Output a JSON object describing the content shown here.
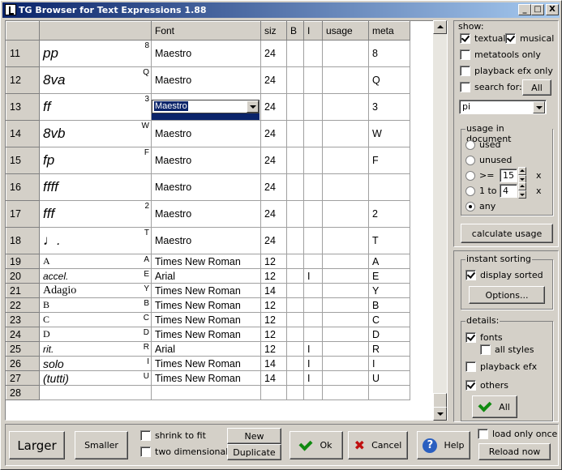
{
  "window": {
    "title": "TG Browser for Text Expressions 1.88",
    "min": "_",
    "max": "□",
    "close": "X"
  },
  "grid": {
    "headers": [
      "",
      "",
      "Font",
      "siz",
      "B",
      "I",
      "usage",
      "meta"
    ],
    "rows": [
      {
        "num": "11",
        "mark": "pp",
        "sup": "8",
        "font": "Maestro",
        "size": "24",
        "b": "",
        "i": "",
        "usage": "",
        "meta": "8"
      },
      {
        "num": "12",
        "mark": "8va",
        "sup": "Q",
        "font": "Maestro",
        "size": "24",
        "b": "",
        "i": "",
        "usage": "",
        "meta": "Q"
      },
      {
        "num": "13",
        "mark": "ff",
        "sup": "3",
        "font": "Maestro",
        "size": "24",
        "b": "",
        "i": "",
        "usage": "",
        "meta": "3"
      },
      {
        "num": "14",
        "mark": "8vb",
        "sup": "W",
        "font": "Maestro",
        "size": "24",
        "b": "",
        "i": "",
        "usage": "",
        "meta": "W"
      },
      {
        "num": "15",
        "mark": "fp",
        "sup": "F",
        "font": "Maestro",
        "size": "24",
        "b": "",
        "i": "",
        "usage": "",
        "meta": "F"
      },
      {
        "num": "16",
        "mark": "ffff",
        "sup": "",
        "font": "Maestro",
        "size": "24",
        "b": "",
        "i": "",
        "usage": "",
        "meta": ""
      },
      {
        "num": "17",
        "mark": "fff",
        "sup": "2",
        "font": "Maestro",
        "size": "24",
        "b": "",
        "i": "",
        "usage": "",
        "meta": "2"
      },
      {
        "num": "18",
        "mark": "♩.",
        "sup": "T",
        "font": "Maestro",
        "size": "24",
        "b": "",
        "i": "",
        "usage": "",
        "meta": "T"
      }
    ],
    "small_rows": [
      {
        "num": "19",
        "mark": "A",
        "sup": "A",
        "style": "roman",
        "font": "Times New Roman",
        "size": "12",
        "b": "",
        "i": "",
        "usage": "",
        "meta": "A"
      },
      {
        "num": "20",
        "mark": "accel.",
        "sup": "E",
        "style": "italic",
        "font": "Arial",
        "size": "12",
        "b": "",
        "i": "I",
        "usage": "",
        "meta": "E"
      },
      {
        "num": "21",
        "mark": "Adagio",
        "sup": "Y",
        "style": "roman-big",
        "font": "Times New Roman",
        "size": "14",
        "b": "",
        "i": "",
        "usage": "",
        "meta": "Y"
      },
      {
        "num": "22",
        "mark": "B",
        "sup": "B",
        "style": "roman",
        "font": "Times New Roman",
        "size": "12",
        "b": "",
        "i": "",
        "usage": "",
        "meta": "B"
      },
      {
        "num": "23",
        "mark": "C",
        "sup": "C",
        "style": "roman",
        "font": "Times New Roman",
        "size": "12",
        "b": "",
        "i": "",
        "usage": "",
        "meta": "C"
      },
      {
        "num": "24",
        "mark": "D",
        "sup": "D",
        "style": "roman",
        "font": "Times New Roman",
        "size": "12",
        "b": "",
        "i": "",
        "usage": "",
        "meta": "D"
      },
      {
        "num": "25",
        "mark": "rit.",
        "sup": "R",
        "style": "italic",
        "font": "Arial",
        "size": "12",
        "b": "",
        "i": "I",
        "usage": "",
        "meta": "R"
      },
      {
        "num": "26",
        "mark": "solo",
        "sup": "I",
        "style": "italic-big",
        "font": "Times New Roman",
        "size": "14",
        "b": "",
        "i": "I",
        "usage": "",
        "meta": "I"
      },
      {
        "num": "27",
        "mark": "(tutti)",
        "sup": "U",
        "style": "italic-big",
        "font": "Times New Roman",
        "size": "14",
        "b": "",
        "i": "I",
        "usage": "",
        "meta": "U"
      },
      {
        "num": "28",
        "mark": "",
        "sup": "",
        "style": "roman",
        "font": "",
        "size": "",
        "b": "",
        "i": "",
        "usage": "",
        "meta": ""
      }
    ],
    "cell_editor_value": "Maestro"
  },
  "show": {
    "label": "show:",
    "textual": "textual",
    "textual_checked": true,
    "musical": "musical",
    "musical_checked": true,
    "metatools_only": "metatools only",
    "playback_efx_only": "playback efx only",
    "search_for": "search for:",
    "all_button": "All",
    "search_value": "pi"
  },
  "usage": {
    "label": "usage in document",
    "used": "used",
    "unused": "unused",
    "gte": ">=",
    "gte_value": "15",
    "x1": "x",
    "range": "1 to",
    "range_value": "4",
    "x2": "x",
    "any": "any",
    "calculate_button": "calculate usage"
  },
  "sorting": {
    "label": "instant sorting",
    "display_sorted": "display sorted",
    "options_button": "Options..."
  },
  "details": {
    "label": "details:",
    "fonts": "fonts",
    "all_styles": "all styles",
    "playback_efx": "playback efx",
    "others": "others",
    "all_button": "All"
  },
  "bottom": {
    "larger": "Larger",
    "smaller": "Smaller",
    "shrink_to_fit": "shrink to fit",
    "two_dimensional": "two dimensional",
    "new": "New",
    "duplicate": "Duplicate",
    "ok": "Ok",
    "cancel": "Cancel",
    "help": "Help",
    "load_only_once": "load only once",
    "reload_now": "Reload now"
  }
}
